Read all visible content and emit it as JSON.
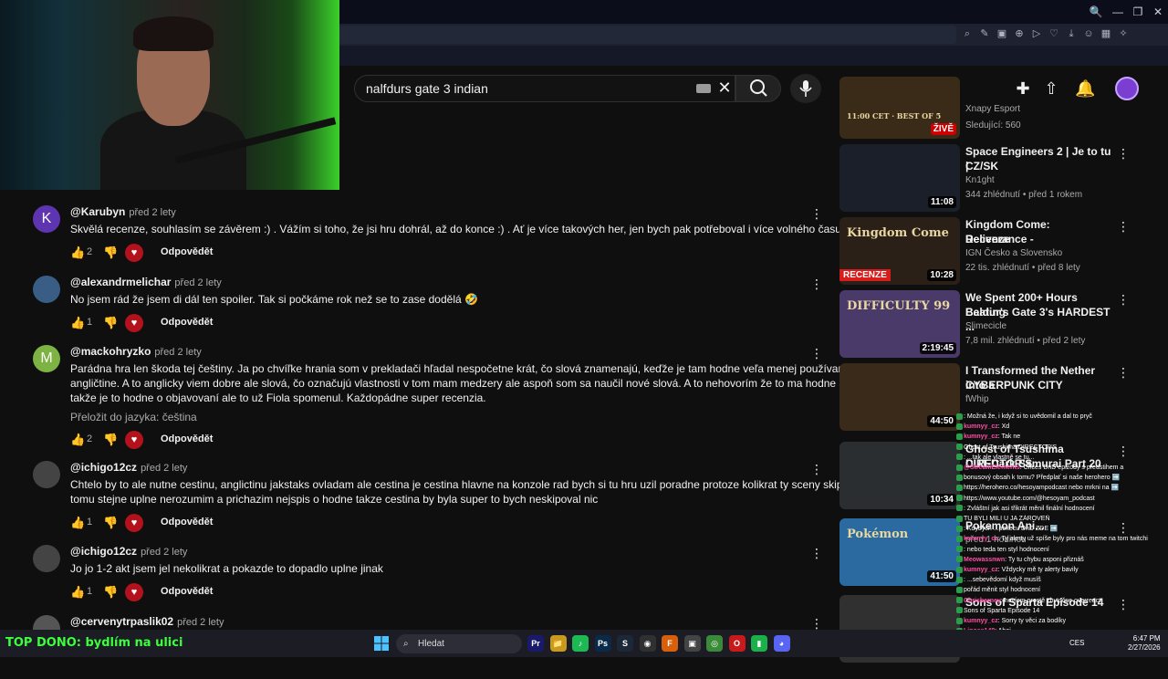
{
  "browser": {
    "window_buttons": [
      "🔍",
      "—",
      "❐",
      "✕"
    ],
    "toolbar_icons": [
      "zoom-icon",
      "edit-icon",
      "camera-icon",
      "ext-icon",
      "play-icon",
      "heart-icon",
      "download-icon",
      "profile-icon",
      "box-icon",
      "ai-icon"
    ]
  },
  "header": {
    "search_value": "nalfdurs gate  3 indian"
  },
  "comments": [
    {
      "avatar_letter": "K",
      "avatar_color": "#5e35b1",
      "handle": "@Karubyn",
      "time": "před 2 lety",
      "text": [
        "Skvělá recenze, souhlasím se závěrem :) . Vážím si toho, že jsi hru dohrál, až do konce :) . Ať je více takových her, jen bych pak potřeboval i více volného času :D ."
      ],
      "likes": "2",
      "reply": "Odpovědět"
    },
    {
      "avatar_letter": "",
      "avatar_color": "#3a5d86",
      "handle": "@alexandrmelichar",
      "time": "před 2 lety",
      "text": [
        "No jsem rád že jsem di dál ten spoiler. Tak si počkáme rok než se to zase dodělá 🤣"
      ],
      "likes": "1",
      "reply": "Odpovědět"
    },
    {
      "avatar_letter": "M",
      "avatar_color": "#7cb342",
      "handle": "@mackohryzko",
      "time": "před 2 lety",
      "text": [
        "Parádna hra len škoda tej češtiny. Ja po chvíľke hrania som v prekladači hľadal nespočetne krát, čo slová znamenajú, keďže je tam hodne veľa menej používaných slov v",
        "angličtine. A to anglicky viem dobre ale slová, čo označujú vlastnosti v tom mam medzery ale aspoň som sa naučil nové slová.  A to nehovorím že to ma hodne slabý návod,",
        "takže je to hodne o objavovaní ale to už Fiola spomenul. Každopádne super recenzia."
      ],
      "translate": "Přeložit do jazyka: čeština",
      "likes": "2",
      "reply": "Odpovědět"
    },
    {
      "avatar_letter": "",
      "avatar_color": "#444444",
      "handle": "@ichigo12cz",
      "time": "před 2 lety",
      "text": [
        "Chtelo by to ale nutne cestinu, anglictinu jakstaks ovladam ale cestina je cestina hlavne na konzole rad bych si tu hru uzil poradne protoze kolikrat ty sceny skipuju protoze",
        "tomu stejne uplne nerozumim a prichazim nejspis o hodne takze cestina by byla super to bych neskipoval nic"
      ],
      "likes": "1",
      "reply": "Odpovědět"
    },
    {
      "avatar_letter": "",
      "avatar_color": "#444444",
      "handle": "@ichigo12cz",
      "time": "před 2 lety",
      "text": [
        "Jo jo 1-2 akt jsem jel nekolikrat a pokazde to dopadlo uplne jinak"
      ],
      "likes": "1",
      "reply": "Odpovědět"
    },
    {
      "avatar_letter": "",
      "avatar_color": "#555555",
      "handle": "@cervenytrpaslik02",
      "time": "před 2 lety",
      "text": [],
      "likes": "",
      "reply": ""
    }
  ],
  "sidebar": [
    {
      "title": [
        "Xnapy Esport"
      ],
      "channel": "Sledující: 560",
      "meta": "",
      "duration": "ŽIVĚ",
      "live": true,
      "thumb_bg": "#3a2a18",
      "thumb_text": "11:00 CET · BEST OF 5"
    },
    {
      "title": [
        "Space Engineers 2 | Je to tu |",
        "CZ/SK"
      ],
      "channel": "Kn1ght",
      "meta": "344 zhlédnutí • před 1 rokem",
      "duration": "11:08",
      "thumb_bg": "#1a1f2a",
      "thumb_text": ""
    },
    {
      "title": [
        "Kingdom Come: Deliverance -",
        "Recenze"
      ],
      "channel": "IGN Česko a Slovensko",
      "meta": "22 tis. zhlédnutí • před 8 lety",
      "duration": "10:28",
      "thumb_bg": "#2a2018",
      "thumb_text": "Kingdom Come",
      "badge": "RECENZE"
    },
    {
      "title": [
        "We Spent 200+ Hours Beating",
        "Baldur's Gate 3's HARDEST ..."
      ],
      "channel": "Slimecicle",
      "meta": "7,8 mil. zhlédnutí • před 2 lety",
      "duration": "2:19:45",
      "thumb_bg": "#4a3a6a",
      "thumb_text": "DIFFICULTY 99"
    },
    {
      "title": [
        "I Transformed the Nether into a",
        "CYBERPUNK CITY"
      ],
      "channel": "fWhip",
      "meta": "",
      "duration": "44:50",
      "thumb_bg": "#3a2a1a",
      "thumb_text": ""
    },
    {
      "title": [
        "Ghost of Tsushima DIRECTOR'S",
        "CUT-Dark Samurai Part 20"
      ],
      "channel": "",
      "meta": "",
      "duration": "10:34",
      "thumb_bg": "#2a2e30",
      "thumb_text": ""
    },
    {
      "title": [
        "Pokemon Ani..."
      ],
      "channel": "",
      "meta": "před 1 hodinou",
      "duration": "41:50",
      "thumb_bg": "#2a6aa0",
      "thumb_text": "Pokémon"
    },
    {
      "title": [
        "Sons of Sparta Episode 14"
      ],
      "channel": "",
      "meta": "",
      "duration": "",
      "thumb_bg": "#303030",
      "thumb_text": ""
    }
  ],
  "chat": [
    {
      "user": "",
      "text": ": Možná že, i když si to uvědomil a dal to pryč"
    },
    {
      "user": "kumnyy_cz",
      "text": ": Xd"
    },
    {
      "user": "kumnyy_cz",
      "text": ": Tak ne"
    },
    {
      "user": "",
      "text": "Ghost of Tsushima DIRECTOR'S"
    },
    {
      "user": "",
      "text": ": ...tak ale vlastně se tu..."
    },
    {
      "user": "@StreamElements",
      "text": ": Chceš DnD epizody s předstihem a"
    },
    {
      "user": "",
      "text": "bonusový obsah k tomu? Předplať si naše herohero ➡️"
    },
    {
      "user": "",
      "text": "https://herohero.co/hesoyampodcast nebo mrkni na ➡️"
    },
    {
      "user": "",
      "text": "https://www.youtube.com/@hesoyam_podcast"
    },
    {
      "user": "",
      "text": ": Zvláštní jak asi třikrát měnil finální hodnocení"
    },
    {
      "user": "",
      "text": "TU BYLI MILI U JA ZÁROVEŇ"
    },
    {
      "user": "",
      "text": ": Kdybych ...pokecu DnD ZDE ➡️"
    },
    {
      "user": "kumnyy_cz",
      "text": ": Ty alerty už spíše byly pro nás meme na tom twitchi"
    },
    {
      "user": "",
      "text": ": nebo teda ten styl hodnocení"
    },
    {
      "user": "Meowassnwn",
      "text": ": Ty tu chybu asponi přiznáš"
    },
    {
      "user": "kumnyy_cz",
      "text": ": Vždycky mě ty alerty bavily"
    },
    {
      "user": "",
      "text": ": ...sebevědomí když musíš"
    },
    {
      "user": "",
      "text": "pořád měnit styl hodnocení"
    },
    {
      "user": "Chrisbarney",
      "text": ": nevíem prostě zbytočne overreact"
    },
    {
      "user": "",
      "text": "Sons of Sparta Episode 14"
    },
    {
      "user": "kumnyy_cz",
      "text": ": Sorry ty věci za bodíky"
    },
    {
      "user": "Liposs148",
      "text": ": Ahoj"
    }
  ],
  "taskbar": {
    "ticker": "TOP DONO: bydlím na ulici",
    "search_placeholder": "Hledat",
    "apps": [
      {
        "name": "premiere-icon",
        "label": "Pr",
        "bg": "#1a1a6a"
      },
      {
        "name": "explorer-icon",
        "label": "📁",
        "bg": "#c89a20"
      },
      {
        "name": "spotify-icon",
        "label": "♪",
        "bg": "#1db954"
      },
      {
        "name": "photoshop-icon",
        "label": "Ps",
        "bg": "#0a2a4a"
      },
      {
        "name": "steam-icon",
        "label": "S",
        "bg": "#1b2838"
      },
      {
        "name": "obs-icon",
        "label": "◉",
        "bg": "#303030"
      },
      {
        "name": "firefox-icon",
        "label": "F",
        "bg": "#d8600a"
      },
      {
        "name": "folder-icon",
        "label": "▣",
        "bg": "#444"
      },
      {
        "name": "chrome-icon",
        "label": "◎",
        "bg": "#3a8a3a"
      },
      {
        "name": "opera-icon",
        "label": "O",
        "bg": "#c81a1a"
      },
      {
        "name": "app-icon",
        "label": "▮",
        "bg": "#1ab04a"
      },
      {
        "name": "discord-icon",
        "label": "◕",
        "bg": "#5865f2"
      }
    ],
    "lang": "CES",
    "time": "6:47 PM",
    "date": "2/27/2026"
  }
}
